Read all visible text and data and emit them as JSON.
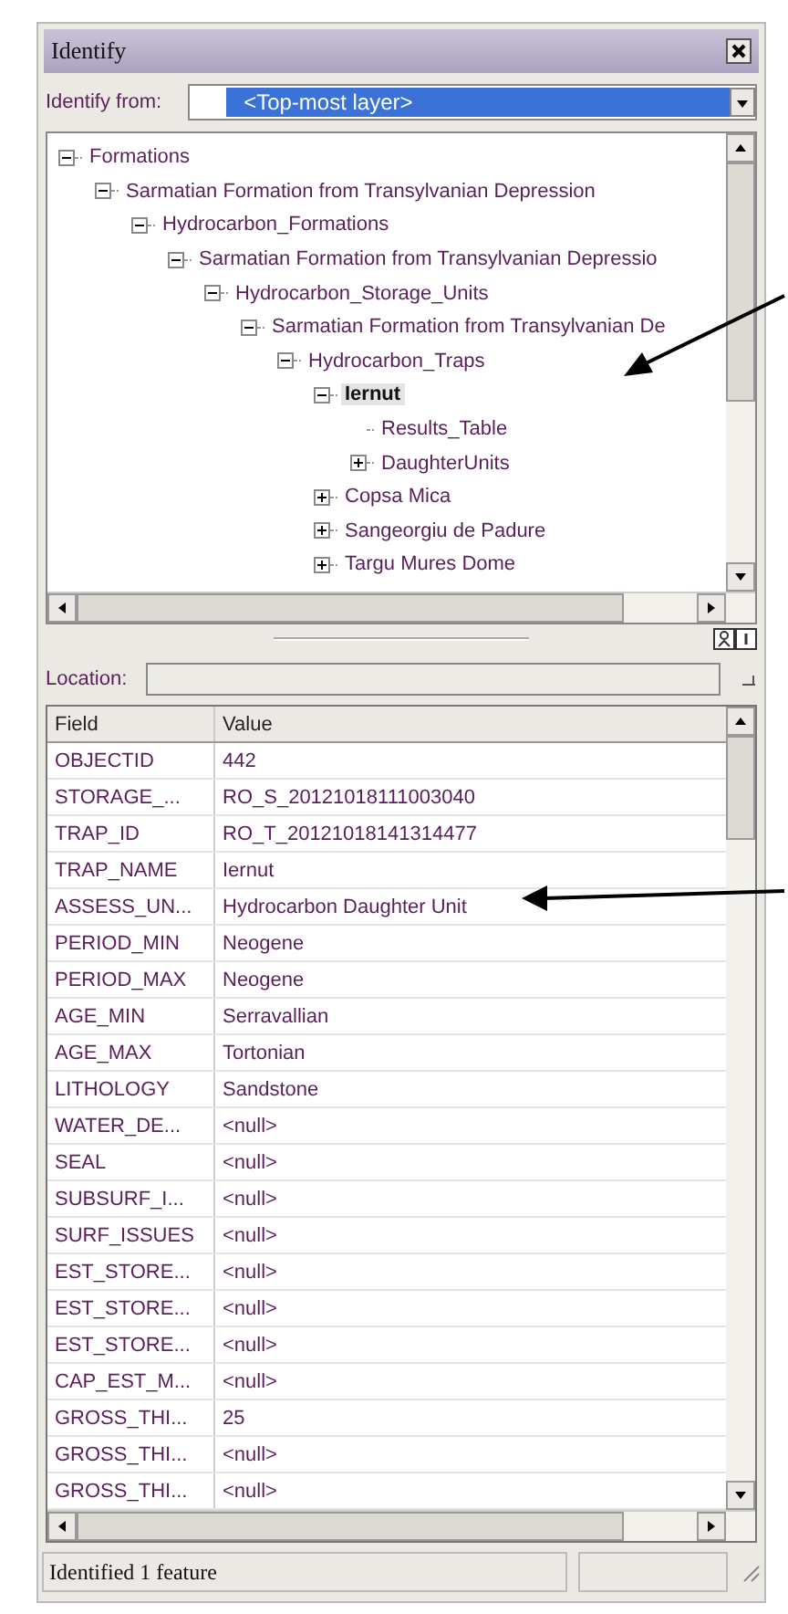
{
  "window": {
    "title": "Identify"
  },
  "identify_from": {
    "label": "Identify from:",
    "value": "<Top-most layer>"
  },
  "tree": [
    {
      "label": "Formations",
      "kind": "group",
      "expanded": true,
      "selected": false,
      "children": [
        {
          "label": "Sarmatian Formation from Transylvanian Depression",
          "kind": "group",
          "expanded": true,
          "selected": false,
          "children": [
            {
              "label": "Hydrocarbon_Formations",
              "kind": "group",
              "expanded": true,
              "selected": false,
              "children": [
                {
                  "label": "Sarmatian Formation  from Transylvanian Depressio",
                  "kind": "group",
                  "expanded": true,
                  "selected": false,
                  "children": [
                    {
                      "label": "Hydrocarbon_Storage_Units",
                      "kind": "group",
                      "expanded": true,
                      "selected": false,
                      "children": [
                        {
                          "label": "Sarmatian Formation from Transylvanian De",
                          "kind": "group",
                          "expanded": true,
                          "selected": false,
                          "children": [
                            {
                              "label": "Hydrocarbon_Traps",
                              "kind": "group",
                              "expanded": true,
                              "selected": false,
                              "children": [
                                {
                                  "label": "Iernut",
                                  "kind": "group",
                                  "expanded": true,
                                  "selected": true,
                                  "children": [
                                    {
                                      "label": "Results_Table",
                                      "kind": "leaf",
                                      "selected": false
                                    },
                                    {
                                      "label": "DaughterUnits",
                                      "kind": "group",
                                      "expanded": false,
                                      "selected": false
                                    }
                                  ]
                                },
                                {
                                  "label": "Copsa Mica",
                                  "kind": "group",
                                  "expanded": false,
                                  "selected": false
                                },
                                {
                                  "label": "Sangeorgiu de Padure",
                                  "kind": "group",
                                  "expanded": false,
                                  "selected": false
                                },
                                {
                                  "label": "Targu Mures Dome",
                                  "kind": "group",
                                  "expanded": false,
                                  "selected": false
                                }
                              ]
                            }
                          ]
                        }
                      ]
                    }
                  ]
                }
              ]
            }
          ]
        }
      ]
    }
  ],
  "location": {
    "label": "Location:"
  },
  "table": {
    "columns": [
      "Field",
      "Value"
    ],
    "rows": [
      {
        "field": "OBJECTID",
        "value": "442"
      },
      {
        "field": "STORAGE_...",
        "value": "RO_S_20121018111003040"
      },
      {
        "field": "TRAP_ID",
        "value": "RO_T_20121018141314477"
      },
      {
        "field": "TRAP_NAME",
        "value": "Iernut"
      },
      {
        "field": "ASSESS_UN...",
        "value": "Hydrocarbon Daughter Unit"
      },
      {
        "field": "PERIOD_MIN",
        "value": "Neogene"
      },
      {
        "field": "PERIOD_MAX",
        "value": "Neogene"
      },
      {
        "field": "AGE_MIN",
        "value": "Serravallian"
      },
      {
        "field": "AGE_MAX",
        "value": "Tortonian"
      },
      {
        "field": "LITHOLOGY",
        "value": "Sandstone"
      },
      {
        "field": "WATER_DE...",
        "value": "<null>"
      },
      {
        "field": "SEAL",
        "value": "<null>"
      },
      {
        "field": "SUBSURF_I...",
        "value": "<null>"
      },
      {
        "field": "SURF_ISSUES",
        "value": "<null>"
      },
      {
        "field": "EST_STORE...",
        "value": "<null>"
      },
      {
        "field": "EST_STORE...",
        "value": "<null>"
      },
      {
        "field": "EST_STORE...",
        "value": "<null>"
      },
      {
        "field": "CAP_EST_M...",
        "value": "<null>"
      },
      {
        "field": "GROSS_THI...",
        "value": "25"
      },
      {
        "field": "GROSS_THI...",
        "value": "<null>"
      },
      {
        "field": "GROSS_THI...",
        "value": "<null>"
      }
    ]
  },
  "status_bar": {
    "text": "Identified 1 feature"
  }
}
